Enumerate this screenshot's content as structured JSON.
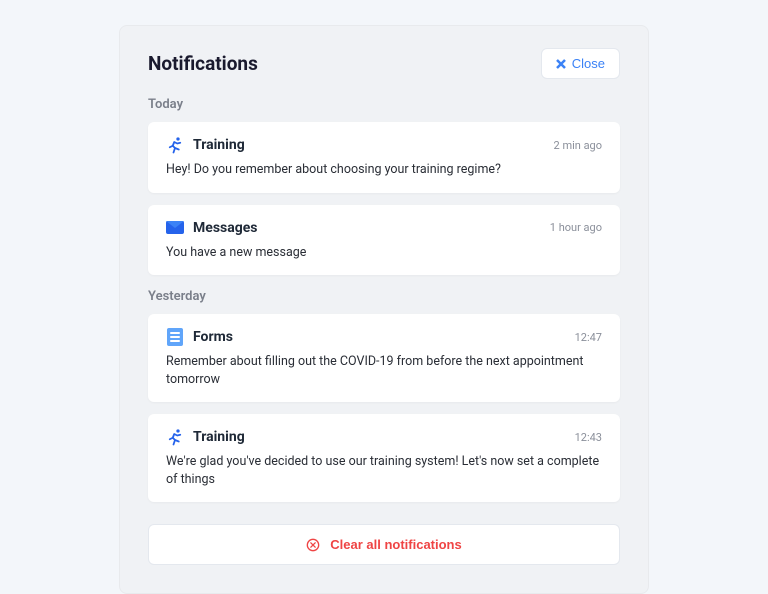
{
  "header": {
    "title": "Notifications",
    "close_label": "Close"
  },
  "sections": {
    "today_label": "Today",
    "yesterday_label": "Yesterday"
  },
  "today": [
    {
      "icon": "running-icon",
      "title": "Training",
      "time": "2 min ago",
      "body": "Hey! Do you remember about choosing your training regime?"
    },
    {
      "icon": "envelope-icon",
      "title": "Messages",
      "time": "1 hour ago",
      "body": "You have a new message"
    }
  ],
  "yesterday": [
    {
      "icon": "form-icon",
      "title": "Forms",
      "time": "12:47",
      "body": "Remember about filling out the COVID-19 from before the next appointment tomorrow"
    },
    {
      "icon": "running-icon",
      "title": "Training",
      "time": "12:43",
      "body": "We're glad you've decided to use our training system! Let's now set a complete of things"
    }
  ],
  "footer": {
    "clear_label": "Clear all notifications"
  },
  "colors": {
    "accent_blue": "#3b82f6",
    "danger_red": "#ef4444"
  }
}
